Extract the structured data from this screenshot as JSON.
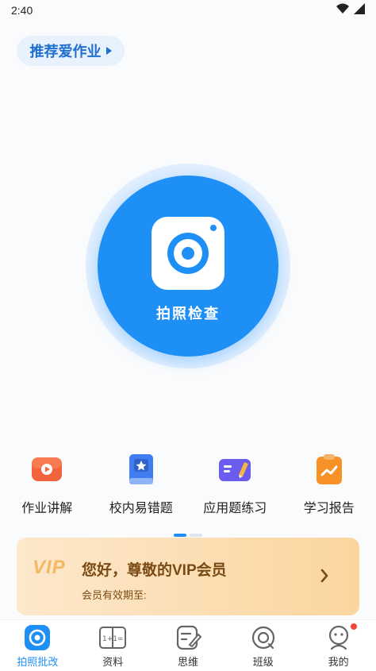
{
  "status_bar": {
    "time": "2:40"
  },
  "promo": {
    "label": "推荐爱作业"
  },
  "camera": {
    "label": "拍照检查"
  },
  "quick_actions": [
    {
      "label": "作业讲解",
      "icon": "video-play-icon",
      "color": "#f4643c"
    },
    {
      "label": "校内易错题",
      "icon": "star-book-icon",
      "color": "#3f7df0"
    },
    {
      "label": "应用题练习",
      "icon": "pencil-book-icon",
      "color": "#6b5cf0"
    },
    {
      "label": "学习报告",
      "icon": "chart-clipboard-icon",
      "color": "#f79226"
    }
  ],
  "vip": {
    "logo": "VIP",
    "title": "您好，尊敬的VIP会员",
    "subtitle": "会员有效期至:"
  },
  "bottom_nav": [
    {
      "label": "拍照批改",
      "icon": "camera-target-icon",
      "active": true
    },
    {
      "label": "资料",
      "icon": "math-book-icon"
    },
    {
      "label": "思维",
      "icon": "note-pencil-icon"
    },
    {
      "label": "班级",
      "icon": "class-circle-icon"
    },
    {
      "label": "我的",
      "icon": "profile-icon",
      "badge": true
    }
  ],
  "colors": {
    "accent": "#1e90f5",
    "vip_text": "#7a4a14"
  }
}
